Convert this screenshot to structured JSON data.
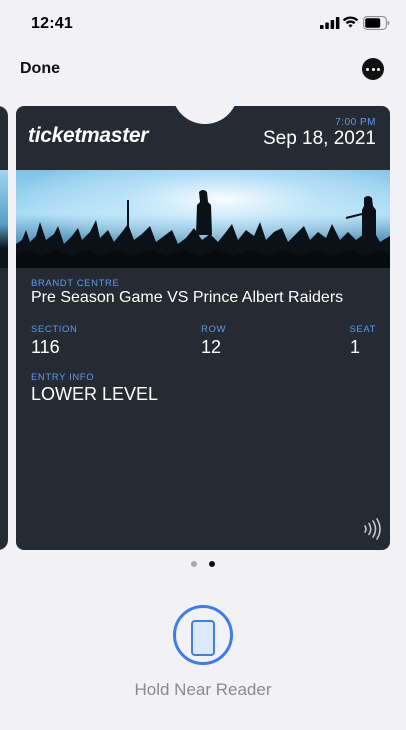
{
  "status_bar": {
    "time": "12:41"
  },
  "nav": {
    "done_label": "Done",
    "more_icon": "ellipsis-circle-icon"
  },
  "pass": {
    "brand": "ticketmaster",
    "event_time": "7:00 PM",
    "event_date": "Sep 18, 2021",
    "venue_label": "BRANDT CENTRE",
    "event_name": "Pre Season Game VS Prince Albert Raiders",
    "section_label": "SECTION",
    "section_value": "116",
    "row_label": "ROW",
    "row_value": "12",
    "seat_label": "SEAT",
    "seat_value": "1",
    "entry_label": "ENTRY INFO",
    "entry_value": "LOWER LEVEL",
    "nfc_icon": "contactless-icon"
  },
  "pager": {
    "total": 2,
    "current": 2
  },
  "reader": {
    "text": "Hold Near Reader",
    "icon": "phone-icon"
  },
  "colors": {
    "background": "#f2f1f6",
    "pass_bg": "#262a33",
    "accent_label": "#5b9cf0",
    "reader_accent": "#3f7ee8"
  }
}
